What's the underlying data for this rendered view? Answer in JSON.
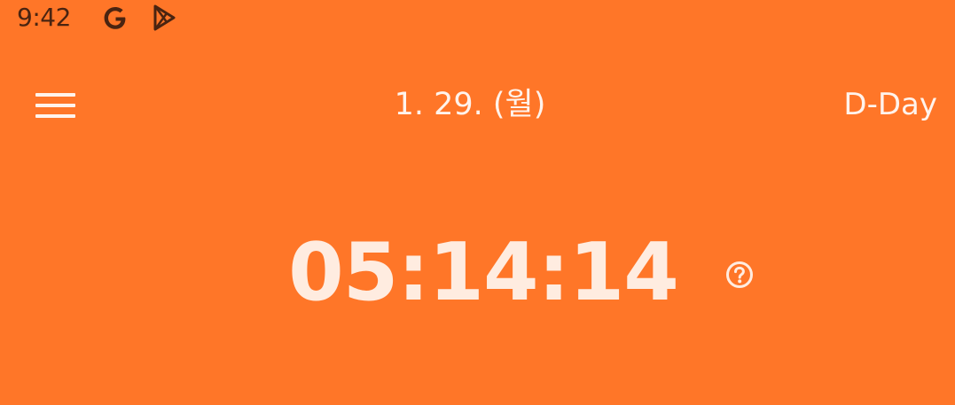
{
  "status_bar": {
    "time": "9:42",
    "icons": [
      "google-g-icon",
      "play-store-icon"
    ]
  },
  "app_bar": {
    "menu_icon": "hamburger-menu-icon",
    "date": "1. 29. (월)",
    "dday_label": "D-Day"
  },
  "timer": {
    "value": "05:14:14",
    "help_icon": "help-circle-icon"
  },
  "colors": {
    "background": "#FF7628",
    "text": "#FFF3EC",
    "status_text": "#4a2411"
  }
}
